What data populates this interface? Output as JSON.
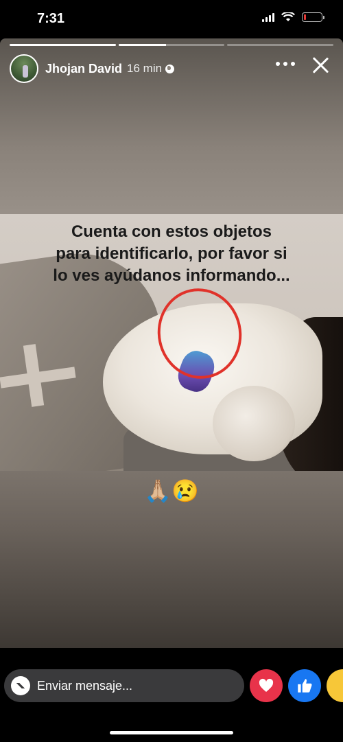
{
  "status_bar": {
    "time": "7:31"
  },
  "story": {
    "progress": [
      1.0,
      0.45,
      0.0
    ],
    "user_name": "Jhojan David",
    "post_time": "16 min",
    "photo_caption": "Cuenta con estos objetos\npara identificarlo, por favor si\nlo ves ayúdanos informando...",
    "emoji_text": "🙏🏼😢"
  },
  "bottom_bar": {
    "message_placeholder": "Enviar mensaje...",
    "reactions": [
      "love-icon",
      "like-icon",
      "haha-icon"
    ]
  },
  "colors": {
    "love": "#e8334a",
    "like": "#1877f2",
    "haha": "#f7c738",
    "circle": "#e0322a"
  }
}
